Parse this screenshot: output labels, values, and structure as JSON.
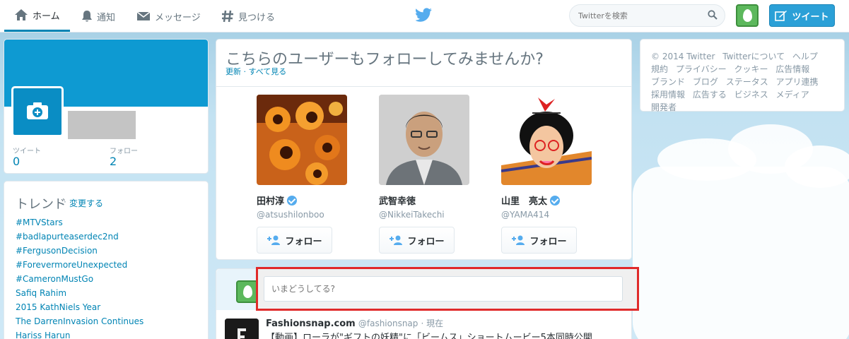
{
  "nav": {
    "home": "ホーム",
    "notifications": "通知",
    "messages": "メッセージ",
    "discover": "見つける"
  },
  "search": {
    "placeholder": "Twitterを検索"
  },
  "tweet_button": "ツイート",
  "profile": {
    "tweets_label": "ツイート",
    "tweets_value": "0",
    "following_label": "フォロー",
    "following_value": "2"
  },
  "trends": {
    "title": "トレンド",
    "separator": "·",
    "change": "変更する",
    "items": [
      "#MTVStars",
      "#badlapurteaserdec2nd",
      "#FergusonDecision",
      "#ForevermoreUnexpected",
      "#CameronMustGo",
      "Safiq Rahim",
      "2015 KathNiels Year",
      "The DarrenInvasion Continues",
      "Hariss Harun"
    ]
  },
  "who_to_follow": {
    "title": "こちらのユーザーもフォローしてみませんか?",
    "links": "更新 · すべて見る",
    "follow_label": "フォロー",
    "users": [
      {
        "name": "田村淳",
        "handle": "@atsushilonboo",
        "verified": true
      },
      {
        "name": "武智幸徳",
        "handle": "@NikkeiTakechi",
        "verified": false
      },
      {
        "name": "山里　亮太",
        "handle": "@YAMA414",
        "verified": true
      }
    ]
  },
  "compose": {
    "placeholder": "いまどうしてる?"
  },
  "timeline": {
    "name": "Fashionsnap.com",
    "handle": "@fashionsnap",
    "time": "· 現在",
    "text": "【動画】ローラが\"ギフトの妖精\"に「ビームス」ショートムービー5本同時公開"
  },
  "footer": {
    "items": [
      "© 2014 Twitter",
      "Twitterについて",
      "ヘルプ",
      "規約",
      "プライバシー",
      "クッキー",
      "広告情報",
      "ブランド",
      "ブログ",
      "ステータス",
      "アプリ連携",
      "採用情報",
      "広告する",
      "ビジネス",
      "メディア",
      "開発者"
    ]
  },
  "colors": {
    "accent": "#0084b4",
    "banner": "#0e9ad2",
    "tweet_button": "#2ba0d7",
    "highlight": "#e02a2a"
  }
}
